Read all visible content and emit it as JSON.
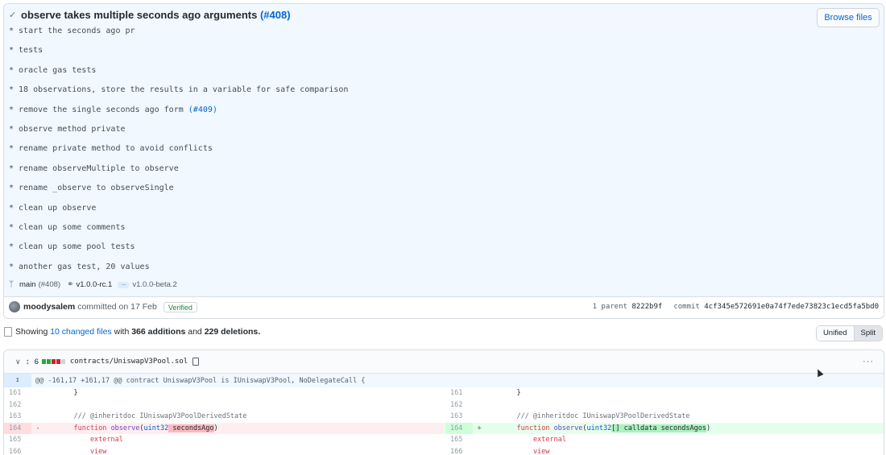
{
  "commit": {
    "title": "observe takes multiple seconds ago arguments",
    "pr_ref": "(#408)",
    "browse_files_label": "Browse files",
    "description_lines": [
      "* start the seconds ago pr",
      "* tests",
      "* oracle gas tests",
      "* 18 observations, store the results in a variable for safe comparison",
      "* remove the single seconds ago form",
      "* observe method private",
      "* rename private method to avoid conflicts",
      "* rename observeMultiple to observe",
      "* rename _observe to observeSingle",
      "* clean up observe",
      "* clean up some comments",
      "* clean up some pool tests",
      "* another gas test, 20 values"
    ],
    "inline_pr_ref": "(#409)",
    "branch": "main",
    "branch_pr": "(#408)",
    "tag_start": "v1.0.0-rc.1",
    "tag_ellipsis": "...",
    "tag_end": "v1.0.0-beta.2",
    "author": "moodysalem",
    "committed_text": "committed on 17 Feb",
    "verified_label": "Verified",
    "parent_label": "1 parent",
    "parent_hash": "8222b9f",
    "commit_label": "commit",
    "commit_hash": "4cf345e572691e0a74f7ede73823c1ecd5fa5bd0"
  },
  "summary": {
    "prefix": "Showing",
    "changed_files": "10 changed files",
    "with": "with",
    "additions": "366 additions",
    "and": "and",
    "deletions": "229 deletions."
  },
  "view_toggle": {
    "unified": "Unified",
    "split": "Split"
  },
  "file": {
    "change_count": "6",
    "path": "contracts/UniswapV3Pool.sol",
    "hunk_header": "@@ -161,17 +161,17 @@ contract UniswapV3Pool is IUniswapV3Pool, NoDelegateCall {",
    "rows": [
      {
        "ln": "161",
        "rn": "161",
        "left": "    }",
        "right": "    }"
      },
      {
        "ln": "162",
        "rn": "162",
        "left": "",
        "right": ""
      },
      {
        "ln": "163",
        "rn": "163",
        "left": "    /// @inheritdoc IUniswapV3PoolDerivedState",
        "right": "    /// @inheritdoc IUniswapV3PoolDerivedState"
      },
      {
        "ln": "164",
        "rn": "164",
        "left_marker": "-",
        "right_marker": "+"
      },
      {
        "ln": "165",
        "rn": "165",
        "left": "        external",
        "right": "        external"
      },
      {
        "ln": "166",
        "rn": "166",
        "left": "        view",
        "right": "        view"
      }
    ],
    "del_line": {
      "kw": "function",
      "fn": "observe",
      "open": "(",
      "type": "uint32",
      "space": " ",
      "highlight": "secondsAgo",
      "close": ")"
    },
    "add_line": {
      "kw": "function",
      "fn": "observe",
      "open": "(",
      "type": "uint32",
      "highlight": "[] calldata secondsAgos",
      "close": ")"
    }
  },
  "colors": {
    "link": "#0366d6",
    "addition_bg": "#e6ffed",
    "deletion_bg": "#ffeef0",
    "verified": "#22863a"
  }
}
